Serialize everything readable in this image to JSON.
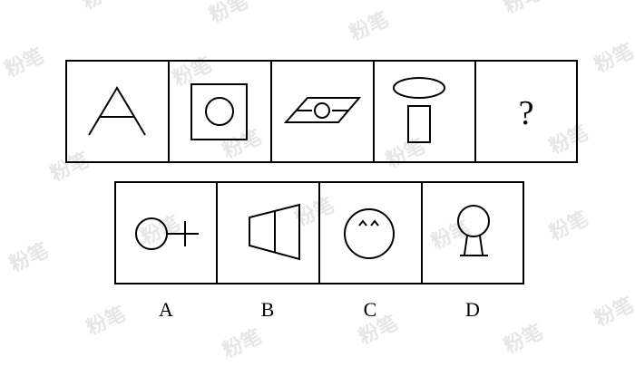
{
  "watermark": {
    "text": "粉笔",
    "logo": "fb-logo"
  },
  "question": {
    "cells": [
      {
        "figure": "letter-a-icon"
      },
      {
        "figure": "circle-in-square-icon"
      },
      {
        "figure": "circle-in-parallelogram-icon"
      },
      {
        "figure": "ellipse-over-rectangle-icon"
      },
      {
        "figure": "unknown",
        "text": "?"
      }
    ]
  },
  "options": [
    {
      "label": "A",
      "figure": "circle-with-cross-line-icon"
    },
    {
      "label": "B",
      "figure": "trapezoid-with-line-icon"
    },
    {
      "label": "C",
      "figure": "smiley-circle-icon"
    },
    {
      "label": "D",
      "figure": "circle-on-stand-icon"
    }
  ]
}
